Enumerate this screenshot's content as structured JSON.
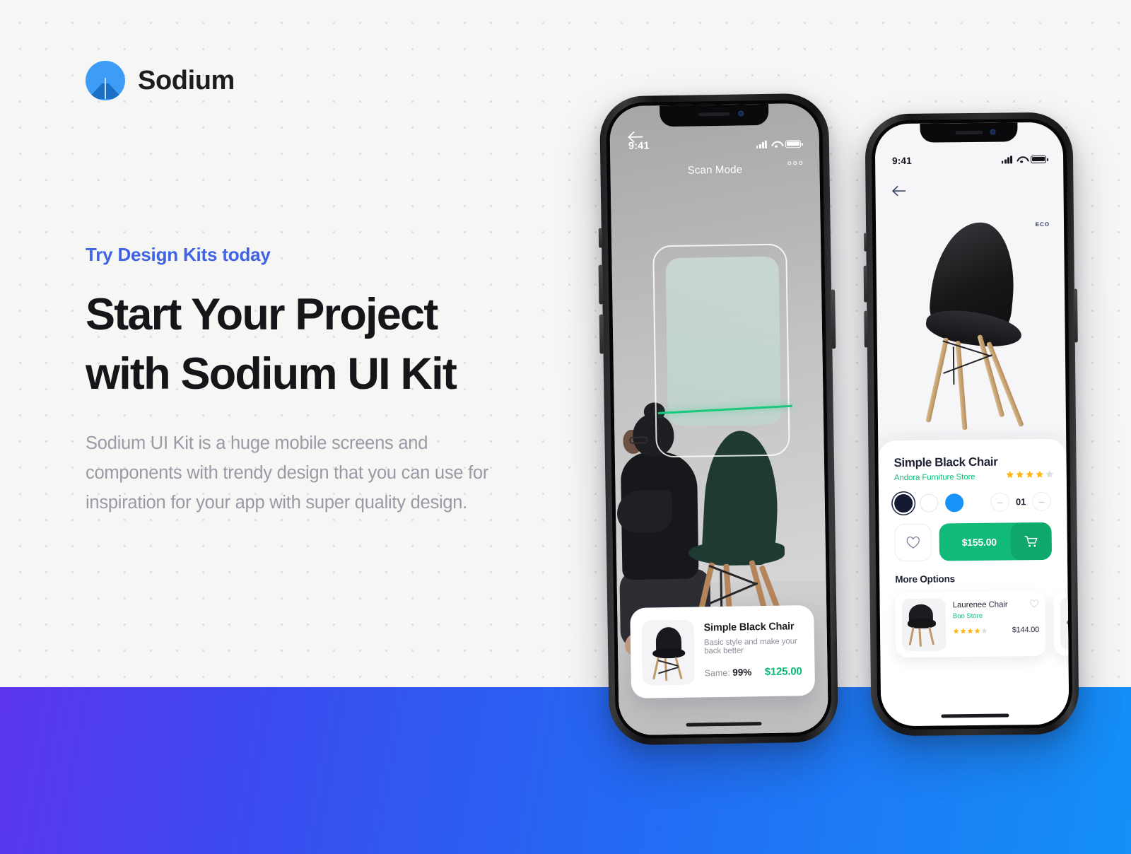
{
  "brand": {
    "name": "Sodium",
    "logo_icon": "tent-mountain-icon",
    "accent": "#3c9cf6"
  },
  "hero": {
    "eyebrow": "Try Design Kits today",
    "eyebrow_color": "#3f63e6",
    "headline_line1": "Start Your Project",
    "headline_line2": "with Sodium UI Kit",
    "blurb": "Sodium UI Kit is a huge mobile screens and components with trendy design that you can use for inspiration for your app with super quality design."
  },
  "background": {
    "top_color": "#f6f6f5",
    "dot_color": "#dedede",
    "gradient_from": "#5c36ec",
    "gradient_to": "#1490f7"
  },
  "phone1": {
    "status": {
      "time": "9:41",
      "signal_icon": "signal-bars-icon",
      "wifi_icon": "wifi-icon",
      "battery_icon": "battery-icon"
    },
    "nav": {
      "title": "Scan Mode",
      "back_icon": "arrow-left-icon",
      "menu_icon": "three-dots-icon"
    },
    "scan": {
      "frame_label": "scan-frame",
      "line_color": "#18c97e"
    },
    "result_card": {
      "title": "Simple Black Chair",
      "description": "Basic style and make your back better",
      "match_label": "Same:",
      "match_value": "99%",
      "price": "$125.00",
      "price_color": "#0bb974"
    }
  },
  "phone2": {
    "status": {
      "time": "9:41",
      "signal_icon": "signal-bars-icon",
      "wifi_icon": "wifi-icon",
      "battery_icon": "battery-icon"
    },
    "nav": {
      "back_icon": "arrow-left-icon",
      "badge": "ECO"
    },
    "product": {
      "title": "Simple Black Chair",
      "store": "Andora Furniture Store",
      "store_color": "#13c07a",
      "rating": 4,
      "rating_max": 5,
      "colors": [
        {
          "name": "black",
          "hex": "#151a33",
          "selected": true
        },
        {
          "name": "white",
          "hex": "#ffffff",
          "selected": false
        },
        {
          "name": "blue",
          "hex": "#1892f8",
          "selected": false
        }
      ],
      "quantity": "01",
      "decrement_label": "–",
      "increment_label": "–",
      "wishlist_icon": "heart-icon",
      "price": "$155.00",
      "cart_icon": "shopping-cart-icon",
      "cart_color": "#12ba79"
    },
    "more_options": {
      "heading": "More Options",
      "items": [
        {
          "title": "Laurenee Chair",
          "store": "Boo Store",
          "rating": 4,
          "rating_max": 5,
          "price": "$144.00",
          "wishlist_icon": "heart-icon"
        }
      ]
    }
  }
}
